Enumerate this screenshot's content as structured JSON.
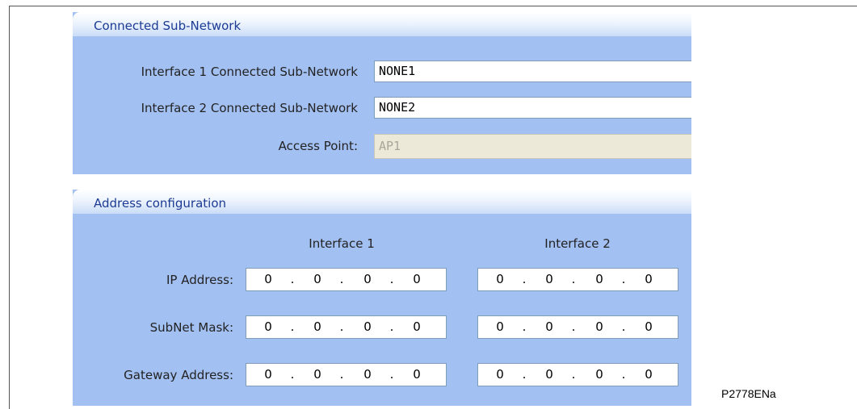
{
  "connected_subnetwork": {
    "title": "Connected Sub-Network",
    "interface1_label": "Interface 1 Connected Sub-Network",
    "interface1_value": "NONE1",
    "interface2_label": "Interface 2 Connected Sub-Network",
    "interface2_value": "NONE2",
    "access_point_label": "Access Point:",
    "access_point_value": "AP1"
  },
  "address_configuration": {
    "title": "Address configuration",
    "column_headers": [
      "Interface 1",
      "Interface 2"
    ],
    "separator": ".",
    "rows": [
      {
        "label": "IP Address:",
        "interface1": [
          "0",
          "0",
          "0",
          "0"
        ],
        "interface2": [
          "0",
          "0",
          "0",
          "0"
        ]
      },
      {
        "label": "SubNet Mask:",
        "interface1": [
          "0",
          "0",
          "0",
          "0"
        ],
        "interface2": [
          "0",
          "0",
          "0",
          "0"
        ]
      },
      {
        "label": "Gateway Address:",
        "interface1": [
          "0",
          "0",
          "0",
          "0"
        ],
        "interface2": [
          "0",
          "0",
          "0",
          "0"
        ]
      }
    ]
  },
  "figure_code": "P2778ENa",
  "colors": {
    "panel_background": "#a3c0f2",
    "header_text": "#1c3b94",
    "input_border": "#7f9db9",
    "disabled_background": "#ece9d8"
  }
}
